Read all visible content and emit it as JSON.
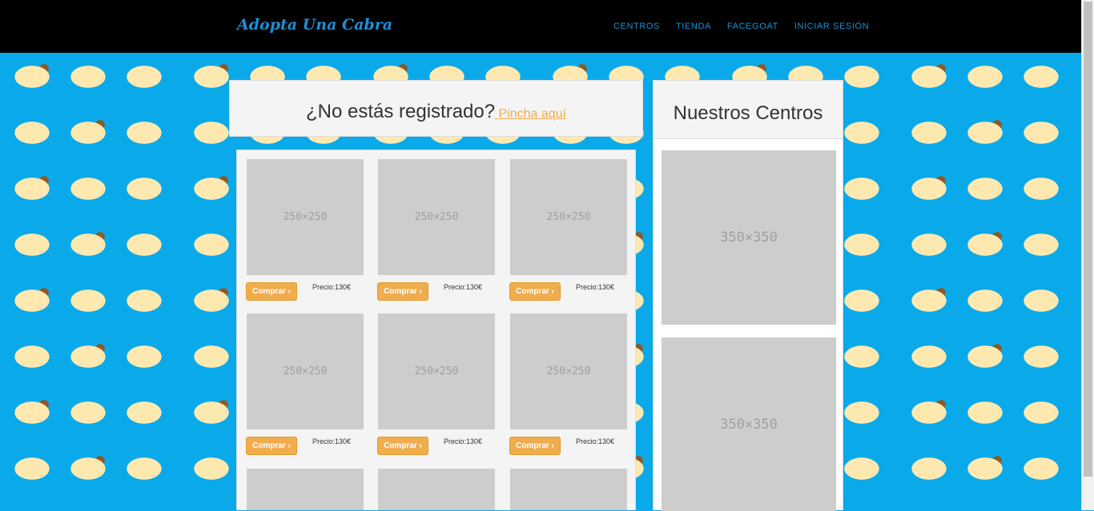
{
  "brand": "Adopta Una Cabra",
  "nav": [
    "CENTROS",
    "TIENDA",
    "FACEGOAT",
    "INICIAR SESIÓN"
  ],
  "register": {
    "text": "¿No estás registrado?",
    "link": " Pincha aquí"
  },
  "products": [
    {
      "img": "250×250",
      "button": "Comprar",
      "price": "Precio:130€"
    },
    {
      "img": "250×250",
      "button": "Comprar",
      "price": "Precio:130€"
    },
    {
      "img": "250×250",
      "button": "Comprar",
      "price": "Precio:130€"
    },
    {
      "img": "250×250",
      "button": "Comprar",
      "price": "Precio:130€"
    },
    {
      "img": "250×250",
      "button": "Comprar",
      "price": "Precio:130€"
    },
    {
      "img": "250×250",
      "button": "Comprar",
      "price": "Precio:130€"
    },
    {
      "img": "",
      "button": "",
      "price": ""
    },
    {
      "img": "",
      "button": "",
      "price": ""
    },
    {
      "img": "",
      "button": "",
      "price": ""
    }
  ],
  "centers": {
    "title": "Nuestros Centros",
    "images": [
      "350×350",
      "350×350"
    ]
  },
  "colors": {
    "accent": "#1e90d6",
    "button": "#f0ad4e",
    "background": "#09a9ea"
  }
}
